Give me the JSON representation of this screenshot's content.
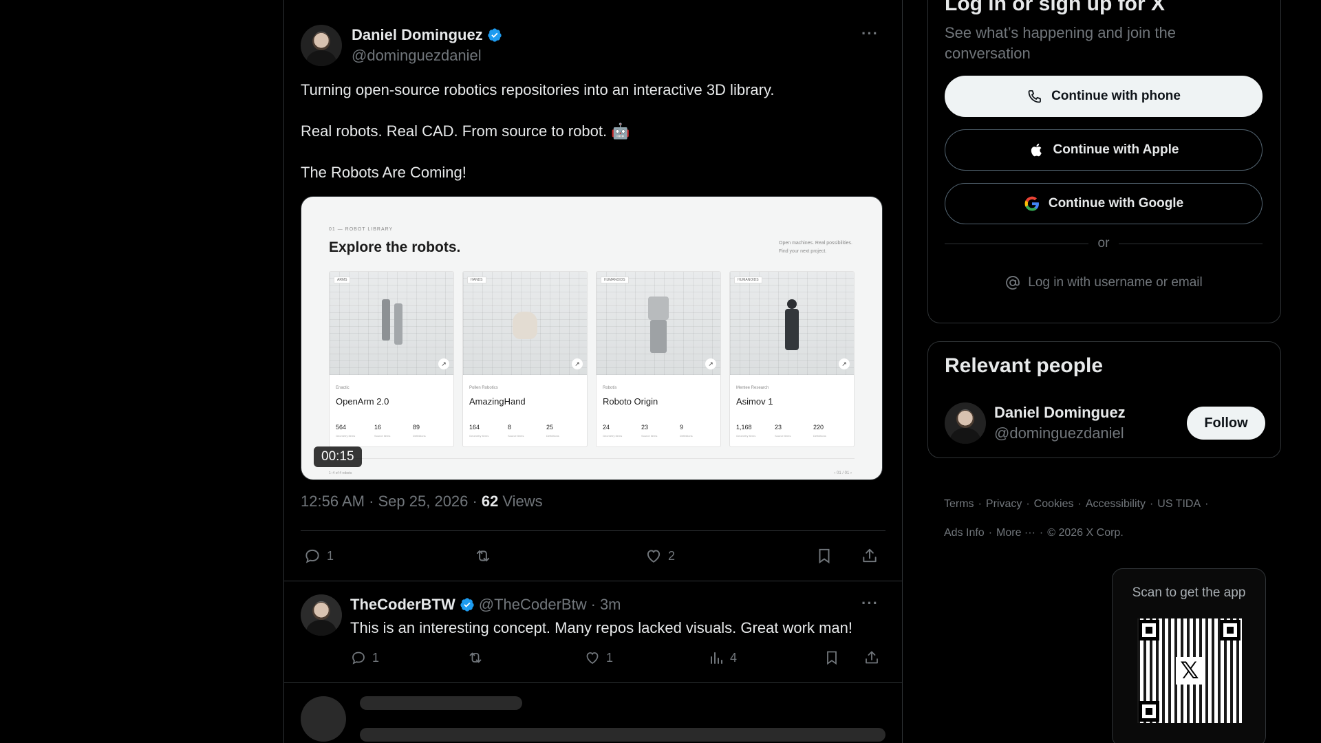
{
  "post": {
    "author_name": "Daniel Dominguez",
    "author_handle": "@dominguezdaniel",
    "more": "···",
    "text_lines": [
      "Turning open-source robotics repositories into an interactive 3D library.",
      "Real robots. Real CAD. From source to robot. 🤖",
      "The Robots Are Coming!"
    ],
    "timestamp": "12:56 AM · Sep 25, 2026 ·",
    "views_count": "62",
    "views_label": "Views",
    "replies": "1",
    "likes": "2"
  },
  "media": {
    "kicker": "01 — ROBOT LIBRARY",
    "title": "Explore the robots.",
    "subtitle": "Open machines. Real possibilities. Find your next project.",
    "duration": "00:15",
    "footer_left": "1–4 of 4 robots",
    "footer_right": "‹   01 / 01   ›",
    "cards": [
      {
        "tag": "ARMS",
        "maker": "Enactic",
        "name": "OpenArm 2.0",
        "stats": [
          "564",
          "16",
          "89"
        ]
      },
      {
        "tag": "HANDS",
        "maker": "Pollen Robotics",
        "name": "AmazingHand",
        "stats": [
          "164",
          "8",
          "25"
        ]
      },
      {
        "tag": "HUMANOIDS",
        "maker": "Robotis",
        "name": "Roboto Origin",
        "stats": [
          "24",
          "23",
          "9"
        ]
      },
      {
        "tag": "HUMANOIDS",
        "maker": "Mentee Research",
        "name": "Asimov 1",
        "stats": [
          "1,168",
          "23",
          "220"
        ]
      }
    ],
    "stat_labels": [
      "Geometry items",
      "Source items",
      "Definitions"
    ]
  },
  "reply": {
    "name": "TheCoderBTW",
    "handle": "@TheCoderBtw",
    "dot": "·",
    "time": "3m",
    "text": "This is an interesting concept. Many repos lacked visuals. Great work man!",
    "replies": "1",
    "likes": "1",
    "views": "4",
    "more": "···"
  },
  "login": {
    "title": "Log in or sign up for X",
    "subtitle": "See what’s happening and join the conversation",
    "phone": "Continue with phone",
    "apple": "Continue with Apple",
    "google": "Continue with Google",
    "or": "or",
    "username": "Log in with username or email"
  },
  "people": {
    "title": "Relevant people",
    "name": "Daniel Dominguez",
    "handle": "@dominguezdaniel",
    "follow": "Follow"
  },
  "footer": {
    "row1": [
      "Terms",
      "Privacy",
      "Cookies",
      "Accessibility",
      "US TIDA"
    ],
    "row2": [
      "Ads Info",
      "More ···",
      "© 2026 X Corp."
    ]
  },
  "qr": {
    "title": "Scan to get the app",
    "logo": "𝕏"
  },
  "colors": {
    "verified": "#1d9bf0",
    "muted": "#71767b",
    "border": "#2f3336"
  }
}
